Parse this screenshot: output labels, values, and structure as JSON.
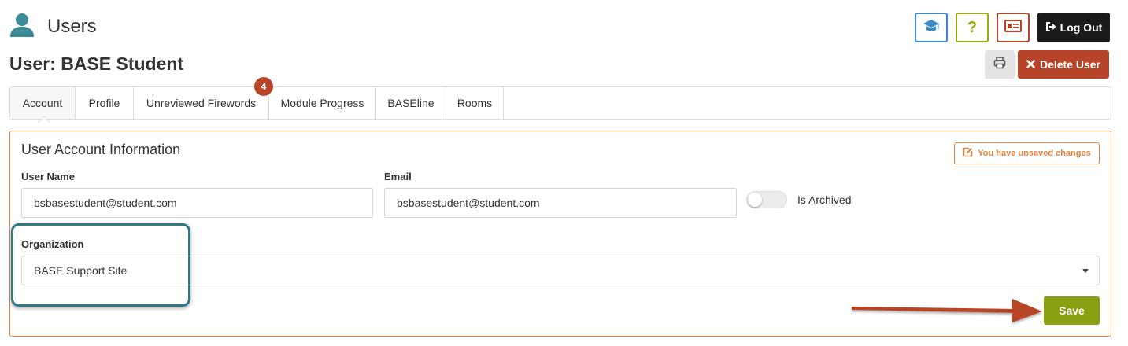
{
  "header": {
    "section_title": "Users",
    "user_title": "User: BASE Student",
    "logout_label": "Log Out",
    "help_label": "?",
    "delete_label": "Delete User"
  },
  "tabs": [
    {
      "label": "Account",
      "active": true
    },
    {
      "label": "Profile",
      "active": false
    },
    {
      "label": "Unreviewed Firewords",
      "active": false,
      "badge": "4"
    },
    {
      "label": "Module Progress",
      "active": false
    },
    {
      "label": "BASEline",
      "active": false
    },
    {
      "label": "Rooms",
      "active": false
    }
  ],
  "panel": {
    "title": "User Account Information",
    "unsaved_label": "You have unsaved changes",
    "fields": {
      "username_label": "User Name",
      "username_value": "bsbasestudent@student.com",
      "email_label": "Email",
      "email_value": "bsbasestudent@student.com",
      "archived_label": "Is Archived",
      "archived_on": false,
      "organization_label": "Organization",
      "organization_value": "BASE Support Site"
    },
    "save_label": "Save"
  },
  "icons": {
    "users": "user-icon",
    "training": "graduation-cap-icon",
    "help": "question-icon",
    "card": "id-card-icon",
    "logout": "sign-out-icon",
    "print": "print-icon",
    "delete": "times-icon",
    "unsaved": "edit-icon"
  },
  "colors": {
    "orange_accent": "#e0823d",
    "danger": "#b74428",
    "save_green": "#8aa012",
    "teal_highlight": "#2e7a8a",
    "training_blue": "#3a8cc8",
    "help_green": "#9aaa10"
  }
}
